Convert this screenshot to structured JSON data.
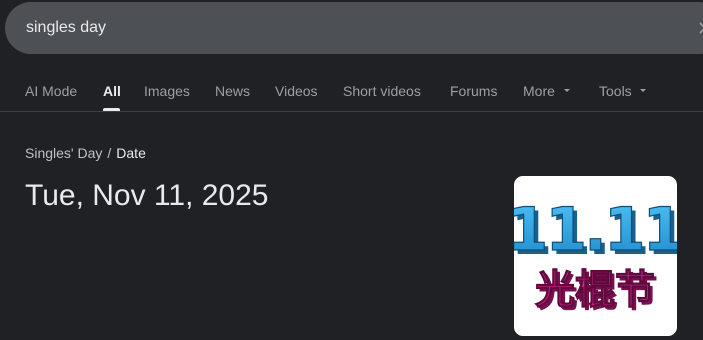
{
  "search": {
    "query": "singles day"
  },
  "tabs": [
    {
      "label": "AI Mode",
      "active": false
    },
    {
      "label": "All",
      "active": true
    },
    {
      "label": "Images",
      "active": false
    },
    {
      "label": "News",
      "active": false
    },
    {
      "label": "Videos",
      "active": false
    },
    {
      "label": "Short videos",
      "active": false
    },
    {
      "label": "Forums",
      "active": false
    },
    {
      "label": "More",
      "active": false,
      "dropdown": true
    },
    {
      "label": "Tools",
      "active": false,
      "dropdown": true
    }
  ],
  "breadcrumb": {
    "parent": "Singles' Day",
    "separator": "/",
    "current": "Date"
  },
  "answer": {
    "text": "Tue, Nov 11, 2025"
  },
  "thumbnail": {
    "number_text": "11.11",
    "chinese_text": "光棍节",
    "colors": {
      "number": "#2a9fd6",
      "number_shadow": "#1b5f8c",
      "chinese": "#d6208a",
      "chinese_shadow": "#7a0f50"
    }
  },
  "icons": {
    "clear": "close-icon",
    "more_caret": "caret-down-icon",
    "tools_caret": "caret-down-icon"
  }
}
